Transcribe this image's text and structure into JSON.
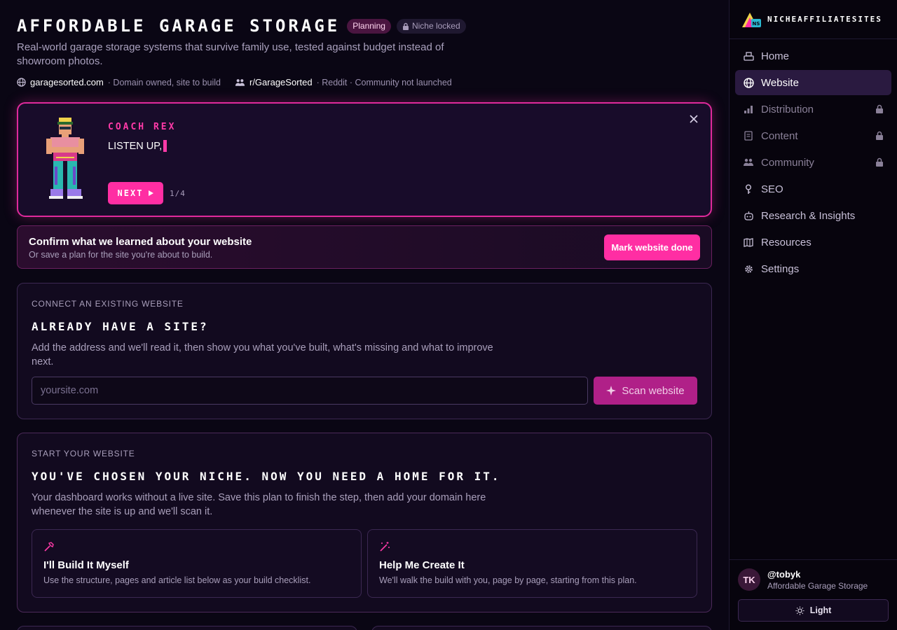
{
  "header": {
    "title": "Affordable Garage Storage",
    "badge_planning": "Planning",
    "badge_locked": "Niche locked",
    "subtitle": "Real-world garage storage systems that survive family use, tested against budget instead of showroom photos.",
    "domain": "garagesorted.com",
    "domain_status": "· Domain owned, site to build",
    "community": "r/GarageSorted",
    "community_status": "· Reddit · Community not launched"
  },
  "coach": {
    "name": "Coach Rex",
    "message": "LISTEN UP,",
    "next_label": "Next",
    "step": "1/4"
  },
  "confirm": {
    "title": "Confirm what we learned about your website",
    "subtitle": "Or save a plan for the site you're about to build.",
    "button": "Mark website done"
  },
  "connect": {
    "eyebrow": "CONNECT AN EXISTING WEBSITE",
    "title": "Already have a site?",
    "description": "Add the address and we'll read it, then show you what you've built, what's missing and what to improve next.",
    "placeholder": "yoursite.com",
    "scan_label": "Scan website"
  },
  "start": {
    "eyebrow": "START YOUR WEBSITE",
    "title": "You've chosen your niche. Now you need a home for it.",
    "description": "Your dashboard works without a live site. Save this plan to finish the step, then add your domain here whenever the site is up and we'll scan it.",
    "options": [
      {
        "title": "I'll Build It Myself",
        "description": "Use the structure, pages and article list below as your build checklist.",
        "icon": "hammer-icon"
      },
      {
        "title": "Help Me Create It",
        "description": "We'll walk the build with you, page by page, starting from this plan.",
        "icon": "magic-wand-icon"
      }
    ]
  },
  "sidebar": {
    "brand": "NicheAffiliateSites",
    "items": [
      {
        "label": "Home",
        "icon": "home-icon",
        "state": "normal"
      },
      {
        "label": "Website",
        "icon": "globe-icon",
        "state": "active"
      },
      {
        "label": "Distribution",
        "icon": "bars-icon",
        "state": "locked"
      },
      {
        "label": "Content",
        "icon": "document-icon",
        "state": "locked"
      },
      {
        "label": "Community",
        "icon": "people-icon",
        "state": "locked"
      },
      {
        "label": "SEO",
        "icon": "key-icon",
        "state": "normal"
      },
      {
        "label": "Research & Insights",
        "icon": "robot-icon",
        "state": "normal"
      },
      {
        "label": "Resources",
        "icon": "map-icon",
        "state": "normal"
      },
      {
        "label": "Settings",
        "icon": "gear-icon",
        "state": "normal"
      }
    ],
    "user": {
      "initials": "TK",
      "handle": "@tobyk",
      "site": "Affordable Garage Storage"
    },
    "theme_label": "Light"
  },
  "colors": {
    "accent": "#ff2ea3",
    "background": "#0a0614",
    "panel": "#120a1f",
    "active_nav": "#2a1a40"
  }
}
